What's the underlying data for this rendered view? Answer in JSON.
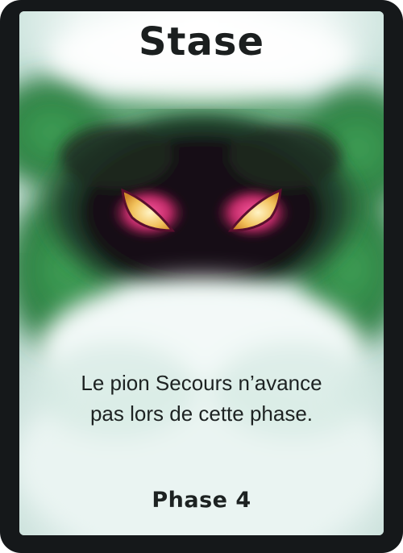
{
  "card": {
    "title": "Stase",
    "rule_line_1": "Le pion Secours n’avance",
    "rule_line_2": "pas lors de cette phase.",
    "phase": "Phase 4"
  },
  "colors": {
    "frame": "#15181a",
    "mist": "#e9f3f2",
    "green_cloud": "#2f8a45",
    "eye_glow": "#d0306a",
    "eye_iris": "#f3c96a",
    "text": "#1d2222"
  },
  "icons": {
    "art": "monster-eyes-in-mist-illustration"
  }
}
